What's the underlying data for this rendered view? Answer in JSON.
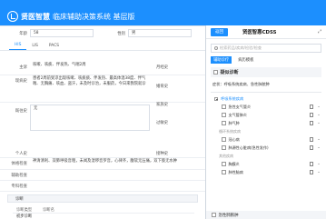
{
  "app": {
    "brand": "贤医智慧",
    "title": "临床辅助决策系统 基层版"
  },
  "form": {
    "tabs": [
      "HIS",
      "LIS",
      "PACS"
    ],
    "active_tab": "HIS",
    "age_label": "年龄",
    "age_value": "58",
    "gender_label": "性别",
    "gender_value": "男",
    "chief_label": "主诉",
    "chief_value": "咳嗽、咳痰、伴发热、气喘2周",
    "present_label": "现病史",
    "present_value": "患者2周前受凉出现咳嗽、咳痰痰、伴发热、最高体温38度、伴气喘、无胸痛、咳血、盗汗，未及时诊治，未服药，今日来我院就诊",
    "past_label": "既往史",
    "past_value": "无",
    "personal_label": "个人史",
    "side_labels": [
      "月经史",
      "婚育史",
      "家族史",
      "过敏史",
      "接种史"
    ],
    "exam_label": "体格检查",
    "exam_value": "神清清利、双肺呼吸音粗，未闻及湿啰音罗音，心律齐，腹软无压痛，双下肢无水肿",
    "aux_label": "辅助检查",
    "special_label": "专科检查",
    "diag_section": "诊断",
    "diag_type_header": "诊断类型",
    "diag_name_header": "诊断名",
    "diag_row_type": "初步诊断"
  },
  "cdss": {
    "back_button": "返回",
    "title": "贤医智惠CDSS",
    "search_placeholder": "检索药品/疾病/检验/检查",
    "subtabs": [
      "辅助诊疗",
      "病历模板"
    ],
    "active_subtab": "辅助诊疗",
    "diagnosis_header": "疑似诊断",
    "hint": "症状：呼吸系统疾病、急性肺脓肿",
    "groups": [
      {
        "name": "呼吸系统疾病",
        "caption": "",
        "items": [
          "急性支气管炎",
          "支气管肺炎",
          "肺气肿"
        ]
      },
      {
        "name": "",
        "caption": "循环系统疾病",
        "items": [
          "冠心病",
          "肺源性心脏病(急性发作)"
        ]
      },
      {
        "name": "",
        "caption": "其他疾病",
        "items": [
          "胸膜炎",
          "肺性脑病"
        ]
      }
    ],
    "bottom_item": "急性肺脓肿",
    "colors": {
      "accent": "#1c8ffe",
      "header": "#1c8ffe"
    }
  }
}
